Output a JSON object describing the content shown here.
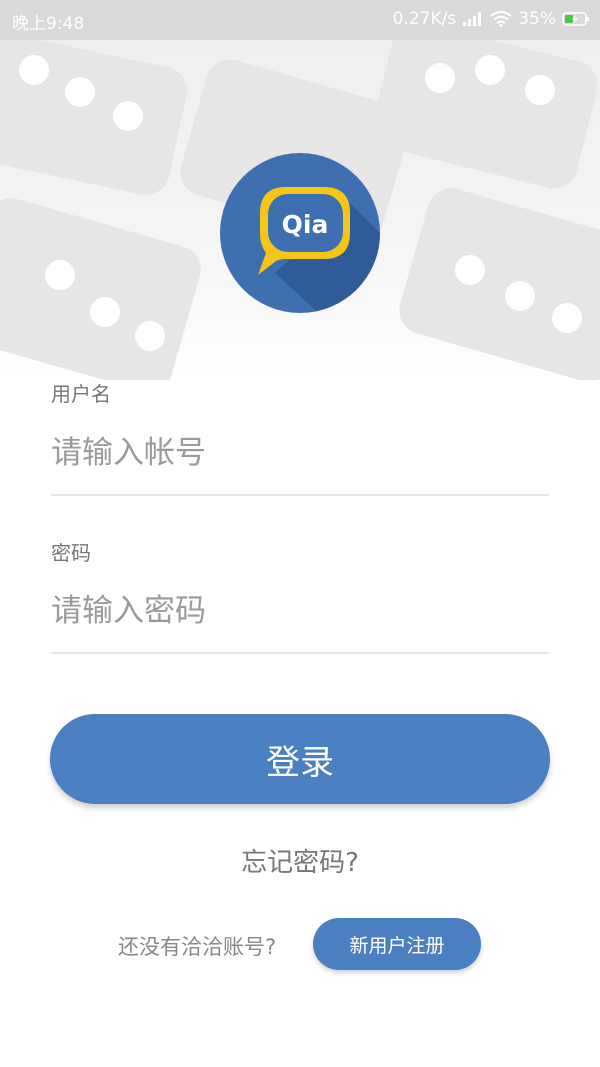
{
  "status_bar": {
    "time": "晚上9:48",
    "network_speed": "0.27K/s",
    "battery": "35%",
    "icons": [
      "signal-icon",
      "wifi-icon",
      "battery-charging-icon"
    ]
  },
  "logo": {
    "text": "Qia",
    "colors": {
      "circle": "#3e6fb1",
      "bubble": "#f5c518"
    }
  },
  "form": {
    "username": {
      "label": "用户名",
      "placeholder": "请输入帐号"
    },
    "password": {
      "label": "密码",
      "placeholder": "请输入密码"
    }
  },
  "actions": {
    "login_label": "登录",
    "forgot_label": "忘记密码?",
    "no_account_text": "还没有洽洽账号?",
    "register_label": "新用户注册"
  },
  "colors": {
    "accent": "#4a7fc1",
    "label": "#777777",
    "status_bar": "#d9d9d9"
  }
}
